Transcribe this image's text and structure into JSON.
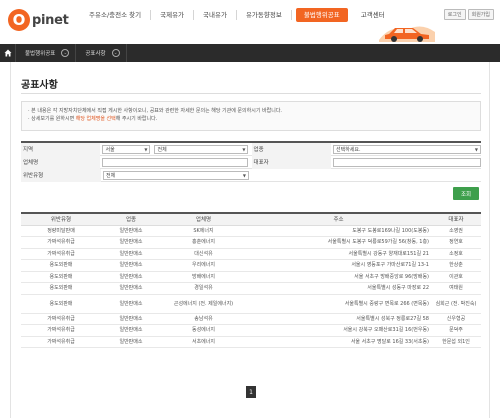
{
  "header": {
    "logo_letter": "O",
    "logo_text": "pinet",
    "nav": [
      "주유소/충전소 찾기",
      "국제유가",
      "국내유가",
      "유가동향정보",
      "불법행위공표",
      "고객센터"
    ],
    "active_index": 4,
    "util": [
      "로그인",
      "회원가입"
    ]
  },
  "location": {
    "items": [
      "불법행위공표",
      "공표사항"
    ]
  },
  "page": {
    "title": "공표사항"
  },
  "notice": {
    "line1": "· 본 내용은 각 지방자치단체에서 직접 게시한 사항이오니, 공표와 관련한 자세한 문의는 해당 기관에 문의하시기 바랍니다.",
    "line2_pre": "· 상세보기를 원하시면 ",
    "line2_hl": "해당 업체명을 선택",
    "line2_post": "해 주시기 바랍니다."
  },
  "search": {
    "region_label": "지역",
    "region_sido": "서울",
    "region_sigungu": "전체",
    "industry_label": "업종",
    "industry_value": "선택하세요.",
    "company_label": "업체명",
    "ceo_label": "대표자",
    "violation_label": "위반유형",
    "violation_value": "전체",
    "button": "조회"
  },
  "table": {
    "headers": [
      "위반유형",
      "업종",
      "업체명",
      "주소",
      "대표자"
    ],
    "rows": [
      [
        "정량미달판매",
        "일반판매소",
        "SK에너지",
        "도봉구 도봉로169나길 100(도봉동)",
        "소영권"
      ],
      [
        "가짜석유취급",
        "일반판매소",
        "홍춘에너지",
        "서울특별시 도봉구 덕릉로59가길 56(창동, 1층)",
        "정연호"
      ],
      [
        "가짜석유취급",
        "일반판매소",
        "대신석유",
        "서울특별시 강동구 양재대로151길 21",
        "소정호"
      ],
      [
        "용도외판매",
        "일반판매소",
        "우리에너지",
        "서울시 영등포구 가마산로71길 13-1",
        "한상춘"
      ],
      [
        "용도외판매",
        "일반판매소",
        "방배에너지",
        "서울 서초구 방배중앙로 96(방배동)",
        "이관호"
      ],
      [
        "용도외판매",
        "일반판매소",
        "경일석유",
        "서울특별시 성동구 마장로 22",
        "여태원"
      ],
      [
        "용도외판매",
        "일반판매소",
        "곤성에너지 (전. 제일에너지)",
        "서울특별시 중랑구 면목로 266 (면목동)",
        "심희근 (전. 박진숙)"
      ],
      [
        "가짜석유취급",
        "일반판매소",
        "송남석유",
        "서울특별시 성북구 정릉로27길 58",
        "신우형공"
      ],
      [
        "가짜석유취급",
        "일반판매소",
        "동성에너지",
        "서울시 강북구 오패산로31길 16(번우동)",
        "문덕주"
      ],
      [
        "가짜석유취급",
        "일반판매소",
        "서초에너지",
        "서울 서초구 명달로 16길 33(서초동)",
        "한문섭 외1인"
      ]
    ]
  },
  "pagination": {
    "current": "1"
  },
  "colors": {
    "accent": "#f26522",
    "search_button": "#3e9f4c",
    "locbar": "#2b2b2b"
  }
}
